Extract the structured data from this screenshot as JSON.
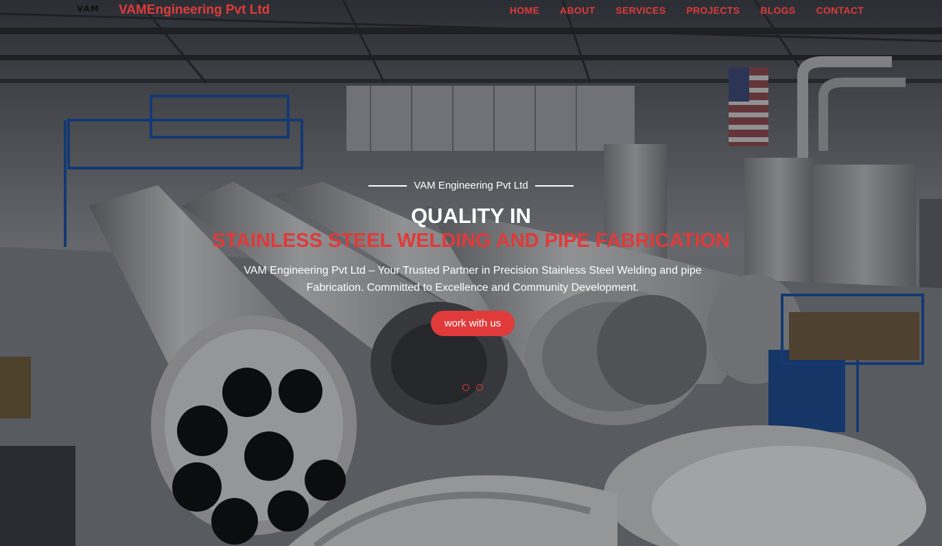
{
  "header": {
    "logo_text": "VAM",
    "brand_name": "VAMEngineering Pvt Ltd",
    "nav": [
      {
        "label": "HOME"
      },
      {
        "label": "ABOUT"
      },
      {
        "label": "SERVICES"
      },
      {
        "label": "PROJECTS"
      },
      {
        "label": "BLOGS"
      },
      {
        "label": "CONTACT"
      }
    ]
  },
  "hero": {
    "eyebrow": "VAM Engineering Pvt Ltd",
    "title_line1": "QUALITY IN",
    "title_line2": "STAINLESS STEEL WELDING AND PIPE FABRICATION",
    "description": "VAM Engineering Pvt Ltd – Your Trusted Partner in Precision Stainless Steel Welding and pipe Fabrication. Committed to Excellence and Community Development.",
    "cta_label": "work with us",
    "slide_count": 2
  },
  "colors": {
    "accent": "#e03a3a",
    "text_light": "#ffffff"
  }
}
